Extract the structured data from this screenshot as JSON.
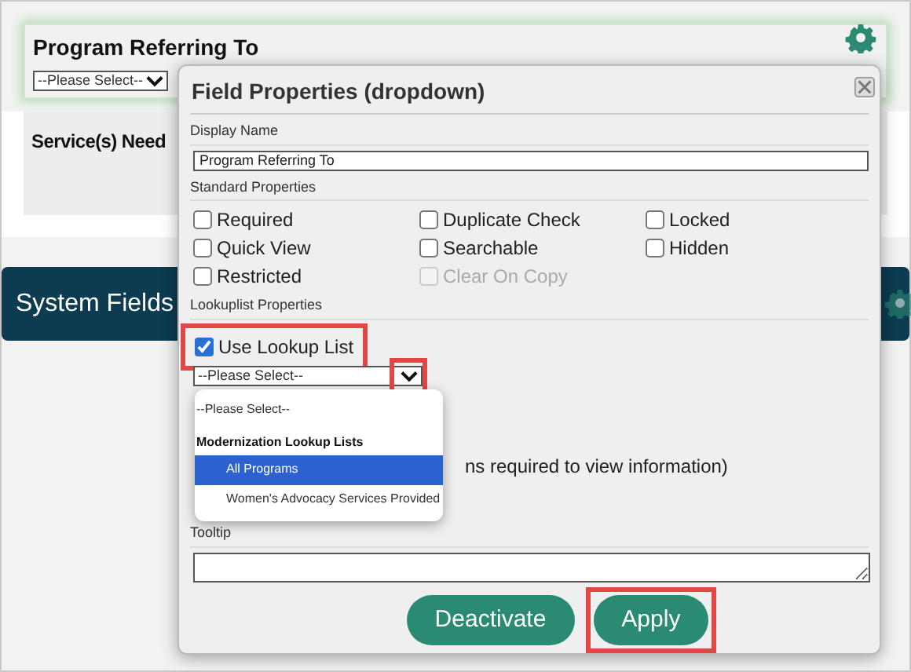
{
  "top_card": {
    "title": "Program Referring To",
    "select_value": "--Please Select--",
    "highlighted": true
  },
  "second_card": {
    "title": "Service(s) Need"
  },
  "section_bar": {
    "title": "System Fields"
  },
  "dialog": {
    "title": "Field Properties (dropdown)",
    "display_name": {
      "label": "Display Name",
      "value": "Program Referring To"
    },
    "standard_properties": {
      "label": "Standard Properties",
      "checkboxes": [
        {
          "label": "Required",
          "checked": false,
          "disabled": false
        },
        {
          "label": "Duplicate Check",
          "checked": false,
          "disabled": false
        },
        {
          "label": "Locked",
          "checked": false,
          "disabled": false
        },
        {
          "label": "Quick View",
          "checked": false,
          "disabled": false
        },
        {
          "label": "Searchable",
          "checked": false,
          "disabled": false
        },
        {
          "label": "Hidden",
          "checked": false,
          "disabled": false
        },
        {
          "label": "Restricted",
          "checked": false,
          "disabled": false
        },
        {
          "label": "Clear On Copy",
          "checked": false,
          "disabled": true
        }
      ]
    },
    "lookuplist": {
      "label": "Lookuplist Properties",
      "use_lookup_list": {
        "label": "Use Lookup List",
        "checked": true,
        "highlighted": true
      },
      "select": {
        "value": "--Please Select--",
        "arrow_highlighted": true
      },
      "dropdown": [
        {
          "kind": "option",
          "label": "--Please Select--",
          "selected": false
        },
        {
          "kind": "group",
          "label": "Modernization Lookup Lists"
        },
        {
          "kind": "option",
          "label": "All Programs",
          "selected": true
        },
        {
          "kind": "option",
          "label": "Women's Advocacy Services Provided",
          "selected": false
        }
      ]
    },
    "partial_text": "ns required to view information)",
    "tooltip": {
      "label": "Tooltip"
    },
    "buttons": [
      {
        "label": "Deactivate"
      },
      {
        "label": "Apply",
        "highlighted": true
      }
    ]
  }
}
